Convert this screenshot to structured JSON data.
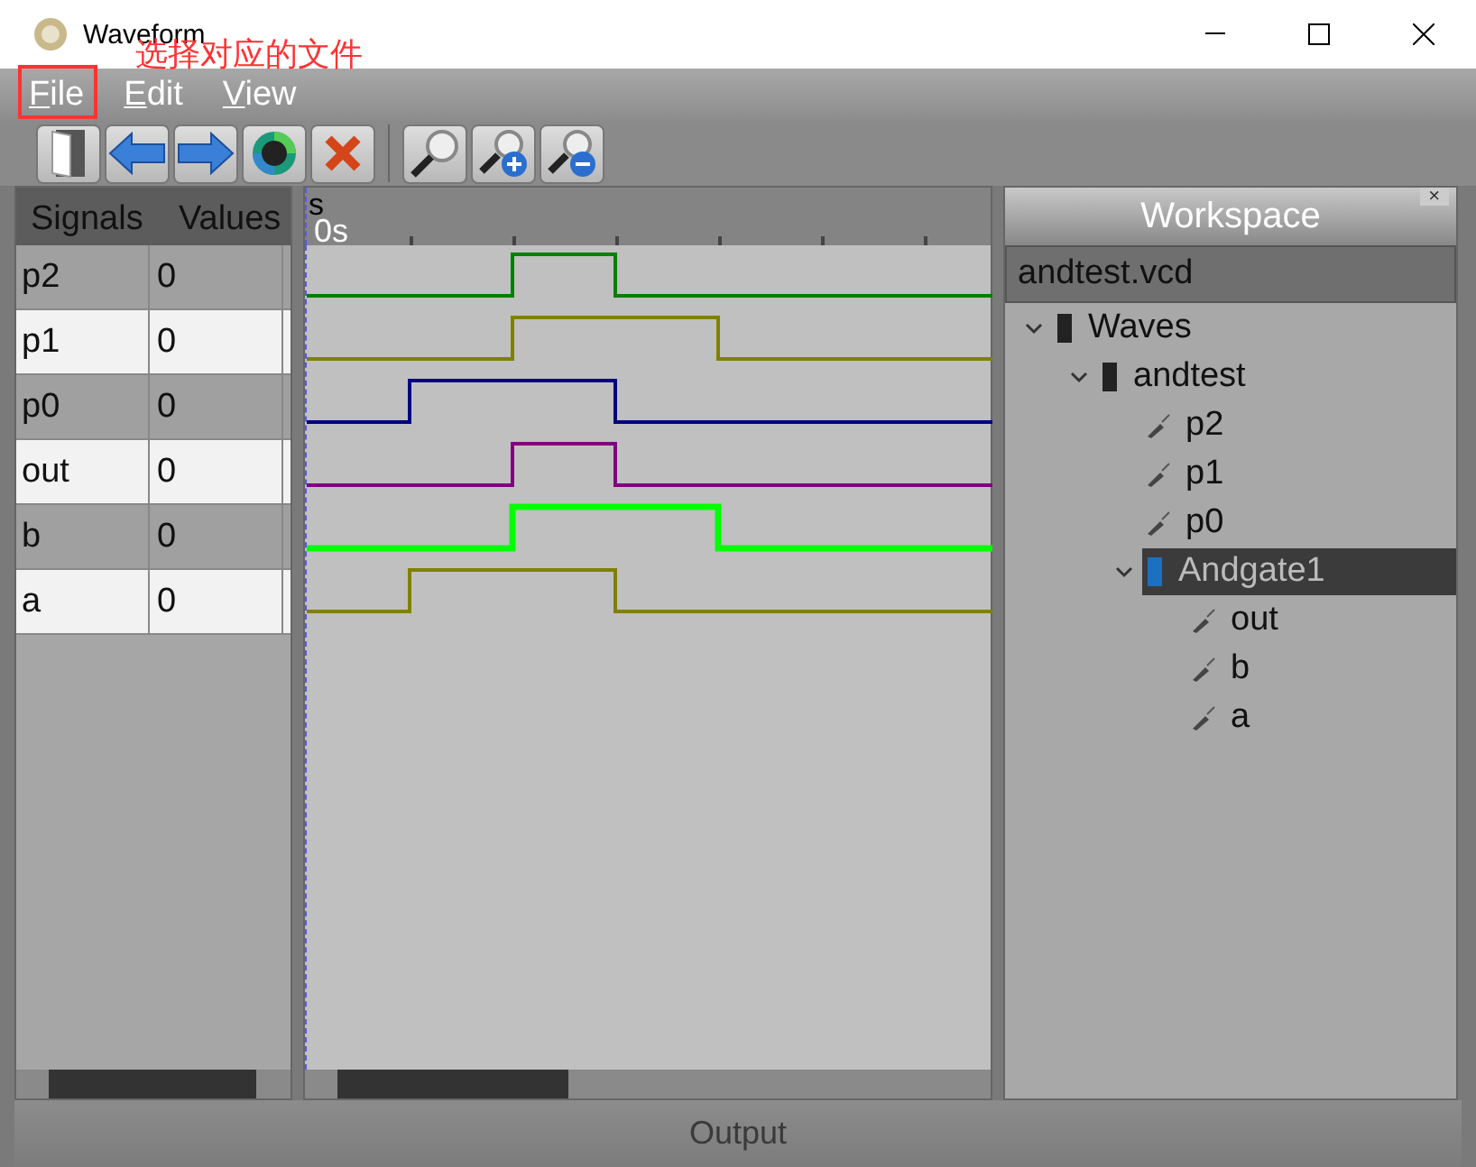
{
  "window": {
    "title": "Waveform"
  },
  "annotation": {
    "text": "选择对应的文件"
  },
  "menu": [
    {
      "label": "File"
    },
    {
      "label": "Edit"
    },
    {
      "label": "View"
    }
  ],
  "toolbar": [
    {
      "kind": "open"
    },
    {
      "kind": "back"
    },
    {
      "kind": "forward"
    },
    {
      "kind": "reload"
    },
    {
      "kind": "remove"
    },
    {
      "kind": "separator"
    },
    {
      "kind": "zoom-fit"
    },
    {
      "kind": "zoom-in"
    },
    {
      "kind": "zoom-out"
    }
  ],
  "signals": {
    "columns": [
      "Signals",
      "Values"
    ],
    "rows": [
      {
        "name": "p2",
        "value": "0"
      },
      {
        "name": "p1",
        "value": "0"
      },
      {
        "name": "p0",
        "value": "0"
      },
      {
        "name": "out",
        "value": "0"
      },
      {
        "name": "b",
        "value": "0"
      },
      {
        "name": "a",
        "value": "0"
      }
    ]
  },
  "timeline": {
    "unit": "s",
    "start": "0s"
  },
  "waves": [
    {
      "color": "#008000"
    },
    {
      "color": "#808000"
    },
    {
      "color": "#000080"
    },
    {
      "color": "#800080"
    },
    {
      "color": "#00ff00"
    },
    {
      "color": "#808000"
    }
  ],
  "workspace": {
    "title": "Workspace",
    "close": "×",
    "file": "andtest.vcd",
    "tree": [
      {
        "label": "Waves",
        "kind": "module",
        "expanded": true,
        "selected": false,
        "children": [
          {
            "label": "andtest",
            "kind": "module",
            "expanded": true,
            "selected": false,
            "children": [
              {
                "label": "p2",
                "kind": "signal",
                "selected": false
              },
              {
                "label": "p1",
                "kind": "signal",
                "selected": false
              },
              {
                "label": "p0",
                "kind": "signal",
                "selected": false
              },
              {
                "label": "Andgate1",
                "kind": "chip",
                "expanded": true,
                "selected": true,
                "children": [
                  {
                    "label": "out",
                    "kind": "signal",
                    "selected": false
                  },
                  {
                    "label": "b",
                    "kind": "signal",
                    "selected": false
                  },
                  {
                    "label": "a",
                    "kind": "signal",
                    "selected": false
                  }
                ]
              }
            ]
          }
        ]
      }
    ]
  },
  "status_bar": {
    "title": "Output"
  }
}
